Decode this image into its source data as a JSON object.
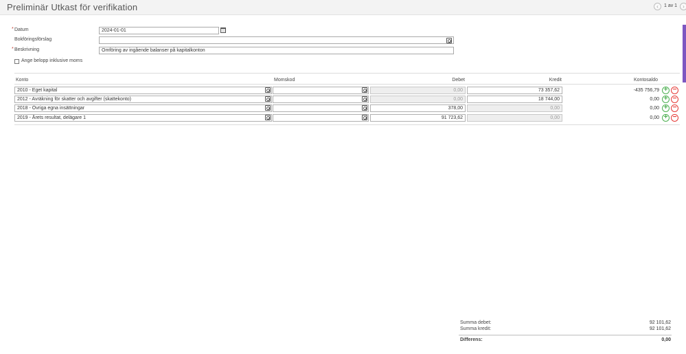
{
  "header": {
    "title": "Preliminär Utkast för verifikation",
    "pager_text": "1 av 1",
    "prev_icon": "‹",
    "next_icon": "›"
  },
  "form": {
    "datum_label": "Datum",
    "datum_value": "2024-01-01",
    "bokforingsforslag_label": "Bokföringsförslag",
    "bokforingsforslag_value": "",
    "beskrivning_label": "Beskrivning",
    "beskrivning_value": "Omföring av ingående balanser på kapitalkonton",
    "inkl_moms_label": "Ange belopp inklusive moms",
    "required_marker": "*"
  },
  "table": {
    "headers": {
      "konto": "Konto",
      "momskod": "Momskod",
      "debet": "Debet",
      "kredit": "Kredit",
      "kontosaldo": "Kontosaldo"
    },
    "rows": [
      {
        "konto": "2010 - Eget kapital",
        "momskod": "",
        "debet": "0,00",
        "kredit": "73 357,62",
        "saldo": "-435 756,79"
      },
      {
        "konto": "2012 - Avräkning för skatter och avgifter (skattekonto)",
        "momskod": "",
        "debet": "0,00",
        "kredit": "18 744,00",
        "saldo": "0,00"
      },
      {
        "konto": "2018 - Övriga egna insättningar",
        "momskod": "",
        "debet": "378,00",
        "kredit": "0,00",
        "saldo": "0,00"
      },
      {
        "konto": "2019 - Årets resultat, delägare 1",
        "momskod": "",
        "debet": "91 723,62",
        "kredit": "0,00",
        "saldo": "0,00"
      }
    ],
    "add_symbol": "+",
    "remove_symbol": "−"
  },
  "summary": {
    "summa_debet_label": "Summa debet:",
    "summa_debet_value": "92 101,62",
    "summa_kredit_label": "Summa kredit:",
    "summa_kredit_value": "92 101,62",
    "differens_label": "Differens:",
    "differens_value": "0,00"
  },
  "colors": {
    "accent": "#7d57c1",
    "required": "#c0392b",
    "add": "#4caf50",
    "remove": "#e53935"
  }
}
